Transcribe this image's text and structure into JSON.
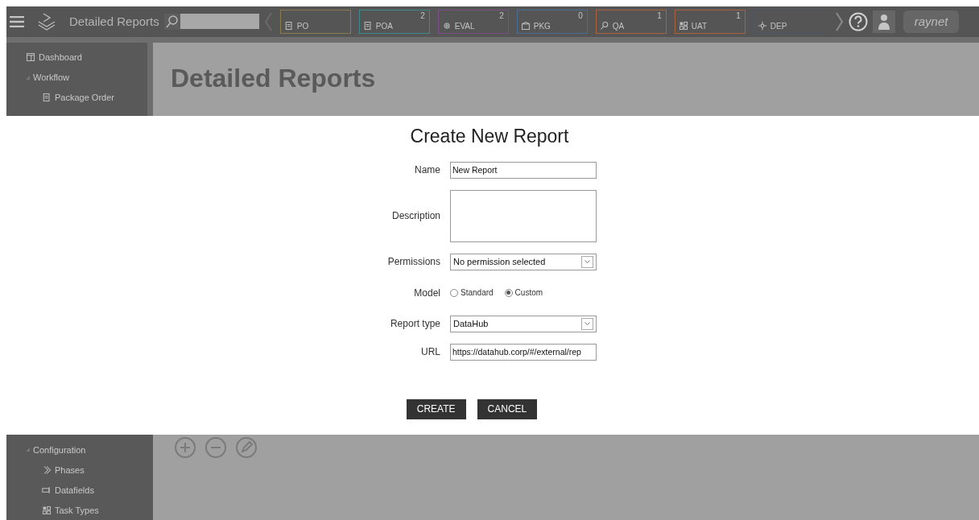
{
  "header": {
    "title": "Detailed Reports",
    "tiles": [
      {
        "label": "PO",
        "kind": "order",
        "color": "#8a7a4c"
      },
      {
        "label": "POA",
        "count": "2",
        "kind": "approval",
        "color": "#3f8a8a"
      },
      {
        "label": "EVAL",
        "count": "2",
        "kind": "gears",
        "color": "#7a4f88"
      },
      {
        "label": "PKG",
        "count": "0",
        "kind": "package",
        "color": "#4a6f96"
      },
      {
        "label": "QA",
        "count": "1",
        "kind": "search",
        "color": "#a8623e"
      },
      {
        "label": "UAT",
        "count": "1",
        "kind": "checklist",
        "color": "#a8623e"
      },
      {
        "label": "DEP",
        "kind": "deploy",
        "color": "#4d5866"
      }
    ],
    "logo": "raynet"
  },
  "sidebar_top": [
    {
      "label": "Dashboard",
      "kind": "item"
    },
    {
      "label": "Workflow",
      "kind": "group"
    },
    {
      "label": "Package Order",
      "kind": "subitem"
    }
  ],
  "page_title": "Detailed Reports",
  "dialog": {
    "title": "Create New Report",
    "fields": [
      {
        "label": "Name",
        "kind": "text",
        "value": "New Report"
      },
      {
        "label": "Description",
        "kind": "textarea"
      },
      {
        "label": "Permissions",
        "kind": "select",
        "value": "No permission selected"
      },
      {
        "label": "Model",
        "kind": "radio",
        "options": [
          {
            "label": "Standard",
            "selected": false
          },
          {
            "label": "Custom",
            "selected": true
          }
        ]
      },
      {
        "label": "Report type",
        "kind": "select",
        "value": "DataHub"
      },
      {
        "label": "URL",
        "kind": "text",
        "value": "https://datahub.corp/#/external/rep"
      }
    ],
    "buttons": [
      "CREATE",
      "CANCEL"
    ]
  },
  "sidebar_bottom": [
    {
      "label": "Configuration",
      "kind": "group"
    },
    {
      "label": "Phases",
      "kind": "subitem"
    },
    {
      "label": "Datafields",
      "kind": "subitem"
    },
    {
      "label": "Task Types",
      "kind": "subitem"
    }
  ]
}
